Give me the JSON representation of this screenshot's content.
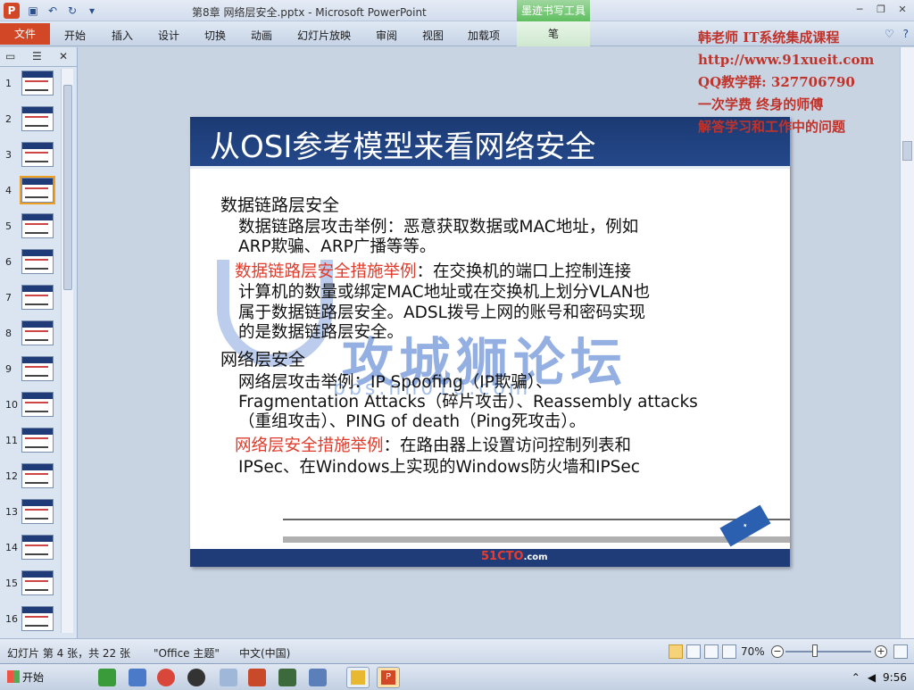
{
  "window": {
    "title": "第8章 网络层安全.pptx - Microsoft PowerPoint",
    "context_title": "墨迹书写工具",
    "app_icon": "P"
  },
  "ribbon": {
    "file_tab": "文件",
    "tabs": [
      "开始",
      "插入",
      "设计",
      "切换",
      "动画",
      "幻灯片放映",
      "审阅",
      "视图",
      "加载项"
    ],
    "context_tab": "笔"
  },
  "promo": {
    "line1": "韩老师 IT系统集成课程",
    "line2": "http://www.91xueit.com",
    "line3": "QQ教学群: 327706790",
    "line4": "一次学费  终身的师傅",
    "line5": "解答学习和工作中的问题"
  },
  "slides_panel": {
    "numbers": [
      "1",
      "2",
      "3",
      "4",
      "5",
      "6",
      "7",
      "8",
      "9",
      "10",
      "11",
      "12",
      "13",
      "14",
      "15",
      "16"
    ],
    "selected_index": 4
  },
  "slide": {
    "title": "从OSI参考模型来看网络安全",
    "sections": {
      "dl_heading": "数据链路层安全",
      "dl_attack_1": "数据链路层攻击举例：恶意获取数据或MAC地址，例如",
      "dl_attack_2": "ARP欺骗、ARP广播等等。",
      "dl_measure_label": "数据链路层安全措施举例",
      "dl_measure_1": "：在交换机的端口上控制连接",
      "dl_measure_2": "计算机的数量或绑定MAC地址或在交换机上划分VLAN也",
      "dl_measure_3": "属于数据链路层安全。ADSL拨号上网的账号和密码实现",
      "dl_measure_4": "的是数据链路层安全。",
      "nl_heading": "网络层安全",
      "nl_attack_1": "网络层攻击举例：IP Spoofing（IP欺骗）、",
      "nl_attack_2": "Fragmentation Attacks（碎片攻击）、Reassembly attacks",
      "nl_attack_3": "（重组攻击）、PING of death（Ping死攻击）。",
      "nl_measure_label": "网络层安全措施举例",
      "nl_measure_1": "：在路由器上设置访问控制列表和",
      "nl_measure_2": "IPSec、在Windows上实现的Windows防火墙和IPSec"
    },
    "watermark": "攻城狮论坛",
    "watermark_url": "bbs.hh010.com",
    "footer_logo": "51CTO",
    "footer_logo_suffix": ".com"
  },
  "status": {
    "slide_info": "幻灯片 第 4 张，共 22 张",
    "theme": "\"Office 主题\"",
    "language": "中文(中国)",
    "zoom": "70%"
  },
  "taskbar": {
    "start": "开始",
    "time": "9:56"
  },
  "colors": {
    "file_tab": "#d24726",
    "slide_header": "#1f3c78",
    "accent_red": "#e03b2b"
  }
}
